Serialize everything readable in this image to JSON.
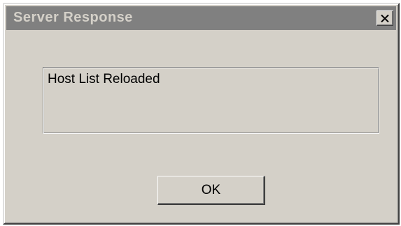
{
  "window": {
    "title": "Server Response",
    "close_icon": "close-icon"
  },
  "message": {
    "text": "Host List Reloaded"
  },
  "buttons": {
    "ok_label": "OK"
  },
  "colors": {
    "titlebar": "#808080",
    "title_text": "#d4d0c8",
    "face": "#d4d0c8"
  }
}
